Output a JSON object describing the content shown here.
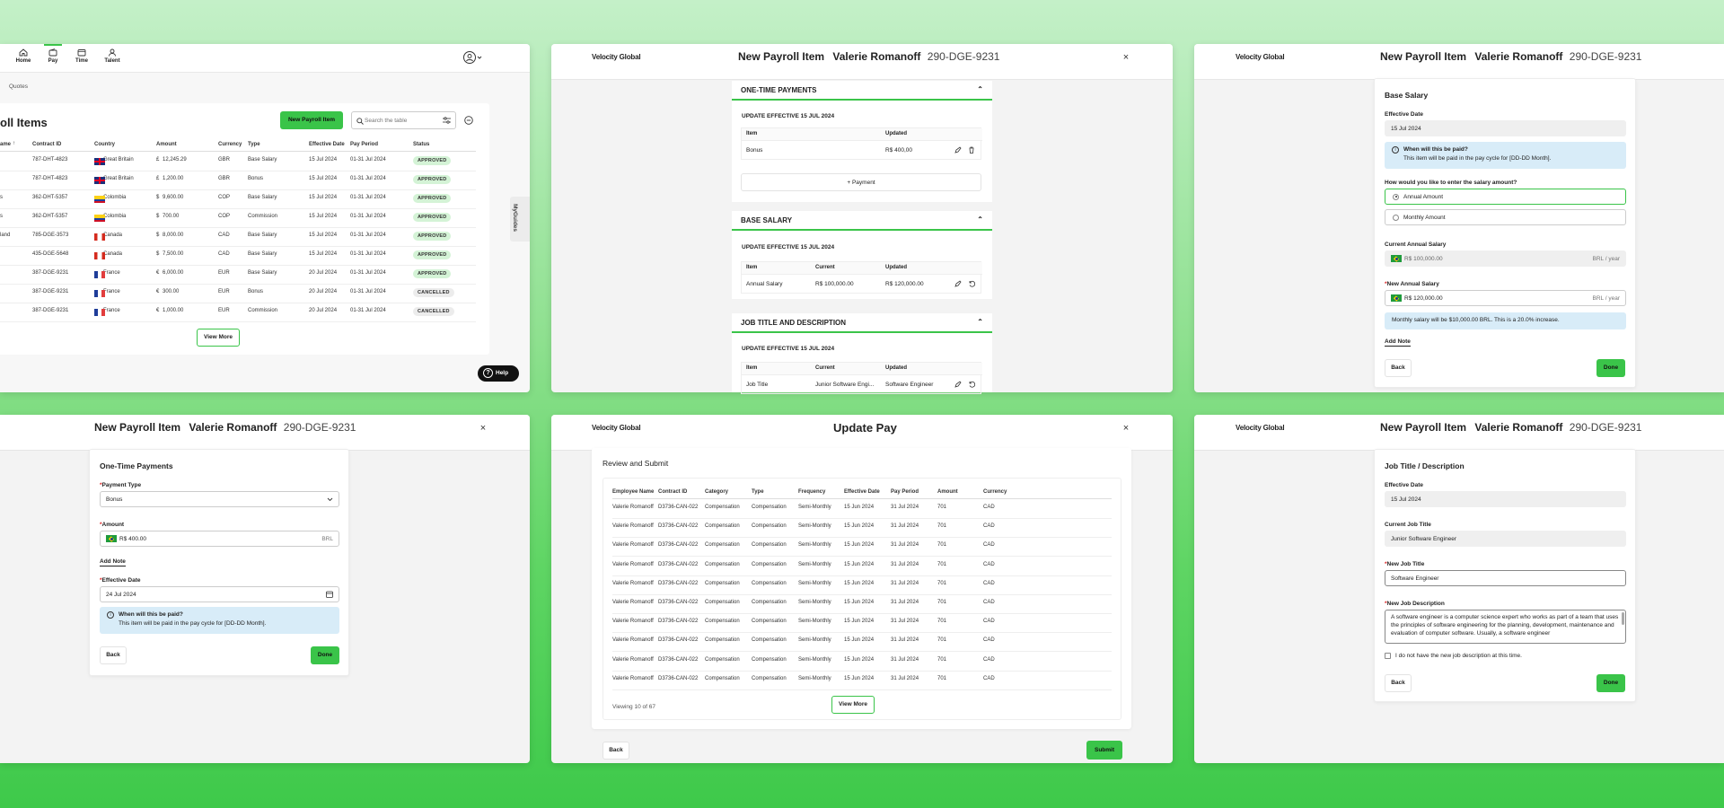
{
  "nav": {
    "items": [
      {
        "label": "Home",
        "icon": "home-icon"
      },
      {
        "label": "Pay",
        "icon": "wallet-icon",
        "active": true
      },
      {
        "label": "Time",
        "icon": "calendar-icon"
      },
      {
        "label": "Talent",
        "icon": "person-icon"
      }
    ],
    "breadcrumb": "Quotes"
  },
  "list": {
    "title": "oll Items",
    "new_button": "New Payroll Item",
    "search_placeholder": "Search the table",
    "columns": [
      "ame",
      "Contract ID",
      "Country",
      "Amount",
      "Currency",
      "Type",
      "Effective Date",
      "Pay Period",
      "Status"
    ],
    "rows": [
      {
        "name": "",
        "contract": "787-DHT-4823",
        "country": "Great Britain",
        "flag": "gb",
        "sym": "£",
        "amount": "12,245.29",
        "currency": "GBR",
        "type": "Base Salary",
        "eff": "15 Jul 2024",
        "period": "01-31 Jul 2024",
        "status": "APPROVED"
      },
      {
        "name": "",
        "contract": "787-DHT-4823",
        "country": "Great Britain",
        "flag": "gb",
        "sym": "£",
        "amount": "1,200.00",
        "currency": "GBR",
        "type": "Bonus",
        "eff": "15 Jul 2024",
        "period": "01-31 Jul 2024",
        "status": "APPROVED"
      },
      {
        "name": "s",
        "contract": "362-DHT-5357",
        "country": "Colombia",
        "flag": "co",
        "sym": "$",
        "amount": "9,600.00",
        "currency": "COP",
        "type": "Base Salary",
        "eff": "15 Jul 2024",
        "period": "01-31 Jul 2024",
        "status": "APPROVED"
      },
      {
        "name": "s",
        "contract": "362-DHT-5357",
        "country": "Colombia",
        "flag": "co",
        "sym": "$",
        "amount": "700.00",
        "currency": "COP",
        "type": "Commission",
        "eff": "15 Jul 2024",
        "period": "01-31 Jul 2024",
        "status": "APPROVED"
      },
      {
        "name": "land",
        "contract": "785-DGE-3573",
        "country": "Canada",
        "flag": "ca",
        "sym": "$",
        "amount": "8,000.00",
        "currency": "CAD",
        "type": "Base Salary",
        "eff": "15 Jul 2024",
        "period": "01-31 Jul 2024",
        "status": "APPROVED"
      },
      {
        "name": "",
        "contract": "435-DGE-5648",
        "country": "Canada",
        "flag": "ca",
        "sym": "$",
        "amount": "7,500.00",
        "currency": "CAD",
        "type": "Base Salary",
        "eff": "15 Jul 2024",
        "period": "01-31 Jul 2024",
        "status": "APPROVED"
      },
      {
        "name": "",
        "contract": "387-DGE-9231",
        "country": "France",
        "flag": "fr",
        "sym": "€",
        "amount": "6,000.00",
        "currency": "EUR",
        "type": "Base Salary",
        "eff": "20 Jul 2024",
        "period": "01-31 Jul 2024",
        "status": "APPROVED"
      },
      {
        "name": "",
        "contract": "387-DGE-9231",
        "country": "France",
        "flag": "fr",
        "sym": "€",
        "amount": "300.00",
        "currency": "EUR",
        "type": "Bonus",
        "eff": "20 Jul 2024",
        "period": "01-31 Jul 2024",
        "status": "CANCELLED"
      },
      {
        "name": "",
        "contract": "387-DGE-9231",
        "country": "France",
        "flag": "fr",
        "sym": "€",
        "amount": "1,000.00",
        "currency": "EUR",
        "type": "Commission",
        "eff": "20 Jul 2024",
        "period": "01-31 Jul 2024",
        "status": "CANCELLED"
      }
    ],
    "view_more": "View More",
    "side_tab": "MyGuides",
    "help": "Help"
  },
  "brand": "Velocity Global",
  "header": {
    "title": "New Payroll Item",
    "employee": "Valerie Romanoff",
    "id": "290-DGE-9231",
    "update_title": "Update Pay"
  },
  "summary": {
    "one_time": {
      "title": "ONE-TIME PAYMENTS",
      "effective": "UPDATE EFFECTIVE 15 JUL 2024",
      "col_item": "Item",
      "col_updated": "Updated",
      "item": "Bonus",
      "updated": "R$ 400,00",
      "add": "+ Payment"
    },
    "base": {
      "title": "BASE SALARY",
      "effective": "UPDATE EFFECTIVE 15 JUL 2024",
      "col_item": "Item",
      "col_current": "Current",
      "col_updated": "Updated",
      "item": "Annual Salary",
      "current": "R$ 100,000.00",
      "updated": "R$ 120,000.00"
    },
    "job": {
      "title": "JOB TITLE AND DESCRIPTION",
      "effective": "UPDATE EFFECTIVE 15 JUL 2024",
      "col_item": "Item",
      "col_current": "Current",
      "col_updated": "Updated",
      "item": "Job Title",
      "current": "Junior Software Engi...",
      "updated": "Software Engineer"
    }
  },
  "salary": {
    "title": "Base Salary",
    "eff_label": "Effective Date",
    "eff_value": "15 Jul 2024",
    "info_title": "When will this be paid?",
    "info_body": "This item will be paid in the pay cycle for [DD-DD Month].",
    "question": "How would you like to enter the salary amount?",
    "opt1": "Annual Amount",
    "opt2": "Monthly Amount",
    "current_label": "Current Annual Salary",
    "current_value": "R$ 100,000.00",
    "unit": "BRL / year",
    "new_label": "New Annual Salary",
    "new_value": "R$ 120,000.00",
    "monthly_info": "Monthly salary will be $10,000.00 BRL. This is a 20.0% increase.",
    "add_note": "Add Note",
    "back": "Back",
    "done": "Done"
  },
  "onetime": {
    "title": "One-Time Payments",
    "type_label": "Payment Type",
    "type_value": "Bonus",
    "amount_label": "Amount",
    "amount_value": "R$ 400.00",
    "amount_unit": "BRL",
    "add_note": "Add Note",
    "eff_label": "Effective Date",
    "eff_value": "24 Jul 2024",
    "info_title": "When will this be paid?",
    "info_body": "This item will be paid in the pay cycle for [DD-DD Month].",
    "back": "Back",
    "done": "Done"
  },
  "review": {
    "title": "Review and Submit",
    "columns": [
      "Employee Name",
      "Contract ID",
      "Category",
      "Type",
      "Frequency",
      "Effective Date",
      "Pay Period",
      "Amount",
      "Currency"
    ],
    "row": [
      "Valerie Romanoff",
      "D3736-CAN-022",
      "Compensation",
      "Compensation",
      "Semi-Monthly",
      "15 Jun 2024",
      "31 Jul 2024",
      "701",
      "CAD"
    ],
    "viewing": "Viewing 10 of 67",
    "view_more": "View More",
    "back": "Back",
    "submit": "Submit"
  },
  "job": {
    "title": "Job Title / Description",
    "eff_label": "Effective Date",
    "eff_value": "15 Jul 2024",
    "cur_label": "Current Job Title",
    "cur_value": "Junior Software Engineer",
    "new_label": "New Job Title",
    "new_value": "Software Engineer",
    "desc_label": "New Job Description",
    "desc_value": "A software engineer is a computer science expert who works as part of a team that uses the principles of software engineering for the planning, development, maintenance and evaluation of computer software. Usually, a software engineer",
    "no_desc": "I do not have the new job description at this time.",
    "back": "Back",
    "done": "Done"
  },
  "colors": {
    "accent": "#3ac449",
    "info": "#d8ecf8"
  }
}
